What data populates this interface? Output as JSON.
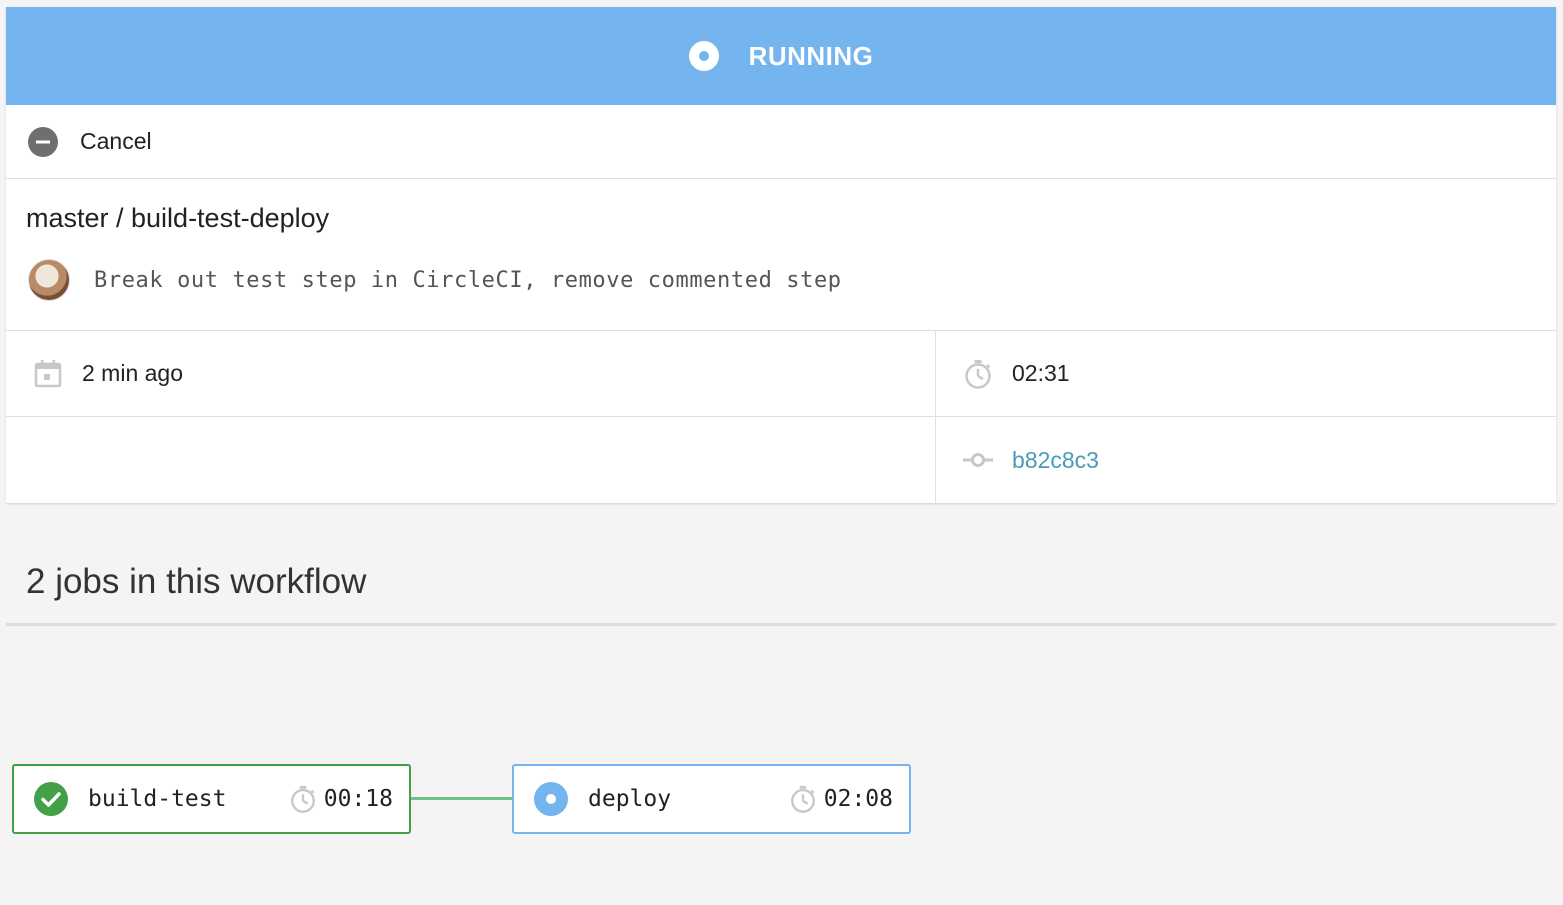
{
  "status": {
    "label": "RUNNING",
    "icon": "running-dot-icon",
    "color": "#74b4ef"
  },
  "actions": {
    "cancel_label": "Cancel",
    "cancel_icon": "minus-circle-icon"
  },
  "workflow": {
    "title": "master / build-test-deploy",
    "commit_message": "Break out test step in CircleCI, remove commented step",
    "avatar_icon": "avatar"
  },
  "meta": {
    "started": "2 min ago",
    "started_icon": "calendar-icon",
    "duration": "02:31",
    "duration_icon": "stopwatch-icon",
    "commit_sha": "b82c8c3",
    "commit_icon": "git-commit-icon"
  },
  "jobs_section": {
    "header": "2 jobs in this workflow"
  },
  "jobs": [
    {
      "name": "build-test",
      "duration": "00:18",
      "status": "success",
      "status_icon": "check-circle-icon",
      "color": "#43a047"
    },
    {
      "name": "deploy",
      "duration": "02:08",
      "status": "running",
      "status_icon": "running-dot-icon",
      "color": "#74b4ef"
    }
  ],
  "colors": {
    "running": "#74b4ef",
    "success": "#43a047",
    "link": "#4a9bb7",
    "connector": "#6cc38a"
  }
}
